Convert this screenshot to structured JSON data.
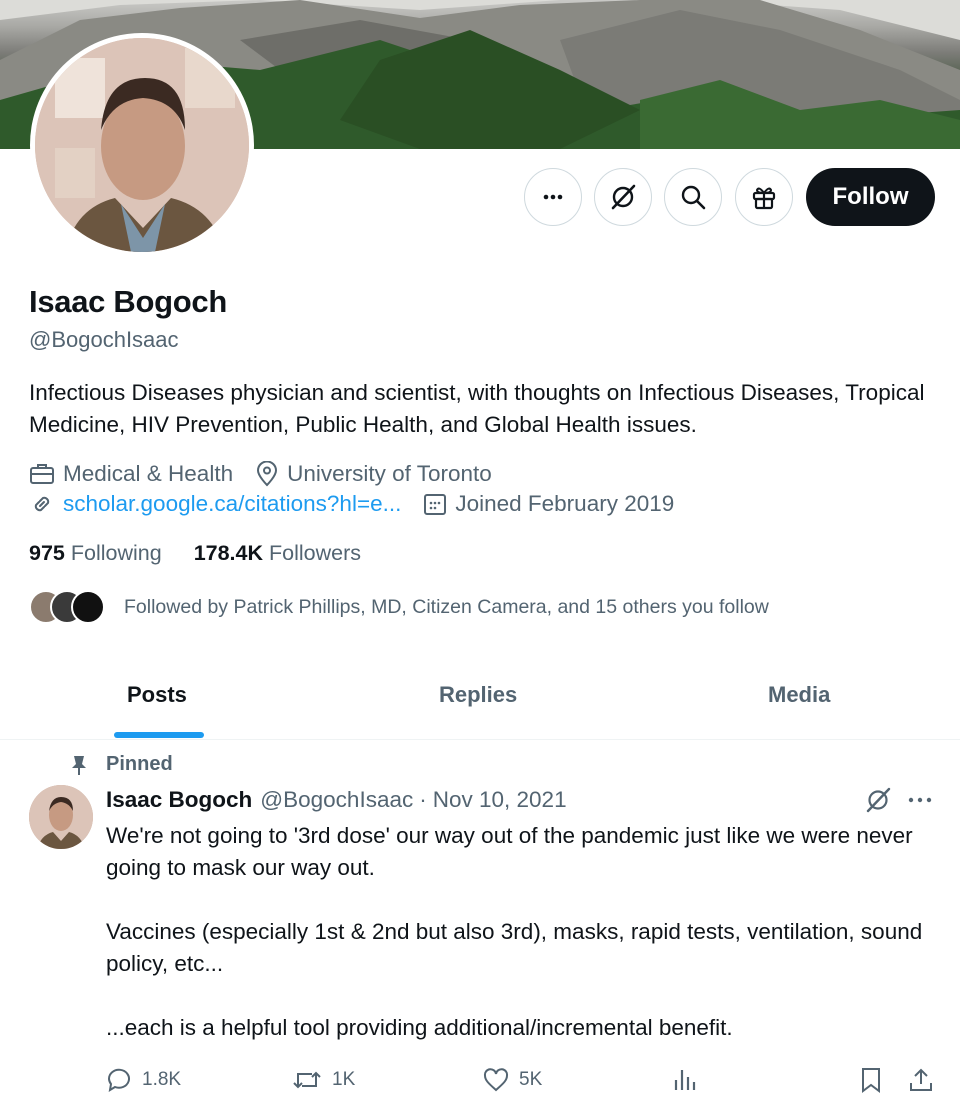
{
  "profile": {
    "name": "Isaac Bogoch",
    "handle": "@BogochIsaac",
    "bio": "Infectious Diseases physician and scientist, with thoughts on Infectious Diseases, Tropical Medicine, HIV Prevention, Public Health, and Global Health issues.",
    "category": "Medical & Health",
    "location": "University of Toronto",
    "website": "scholar.google.ca/citations?hl=e...",
    "joined": "Joined February 2019",
    "following_count": "975",
    "following_label": "Following",
    "followers_count": "178.4K",
    "followers_label": "Followers",
    "followed_by": "Followed by Patrick Phillips, MD, Citizen Camera, and 15 others you follow"
  },
  "actions": {
    "more_icon": "more-dots-icon",
    "grok_icon": "grok-icon",
    "search_icon": "search-icon",
    "gift_icon": "gift-icon",
    "follow_label": "Follow"
  },
  "tabs": [
    {
      "label": "Posts",
      "active": true
    },
    {
      "label": "Replies",
      "active": false
    },
    {
      "label": "Media",
      "active": false
    }
  ],
  "tweet": {
    "pinned_label": "Pinned",
    "author_name": "Isaac Bogoch",
    "author_handle": "@BogochIsaac",
    "separator": "·",
    "date": "Nov 10, 2021",
    "body_1": "We're not going to '3rd dose' our way out of the pandemic just like we were never going to mask our way out.",
    "body_2": "Vaccines (especially 1st & 2nd but also 3rd), masks, rapid tests, ventilation, sound policy, etc...",
    "body_3": "...each is a helpful tool providing additional/incremental benefit.",
    "replies": "1.8K",
    "reposts": "1K",
    "likes": "5K"
  },
  "colors": {
    "accent": "#1d9bf0",
    "text_primary": "#0f1419",
    "text_secondary": "#536471",
    "border": "#cfd9de"
  }
}
